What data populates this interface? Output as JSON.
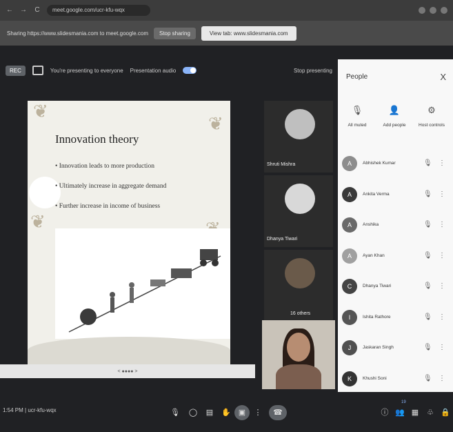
{
  "browser": {
    "url": "meet.google.com/ucr-kfu-wqx",
    "back": "←",
    "forward": "→",
    "reload": "C"
  },
  "share_bar": {
    "text": "Sharing https://www.slidesmania.com to meet.google.com",
    "stop_label": "Stop sharing",
    "view_label": "View tab: www.slidesmania.com"
  },
  "present_bar": {
    "rec": "REC",
    "presenting_text": "You're presenting to everyone",
    "audio_label": "Presentation audio",
    "stop_label": "Stop presenting"
  },
  "slide": {
    "title": "Innovation theory",
    "bullets": [
      "• Innovation leads to more production",
      "• Ultimately increase in aggregate demand",
      "• Further increase in income of business"
    ],
    "page_indicator": "< ●●●● >"
  },
  "tiles": [
    {
      "name": "Shruti Mishra"
    },
    {
      "name": "Dhanya Tiwari"
    },
    {
      "name": "16 others"
    }
  ],
  "people_panel": {
    "title": "People",
    "close": "X",
    "actions": [
      {
        "icon": "mic-off-icon",
        "glyph": "🎙",
        "label": "All muted"
      },
      {
        "icon": "add-person-icon",
        "glyph": "👤",
        "label": "Add people"
      },
      {
        "icon": "host-controls-icon",
        "glyph": "⚙",
        "label": "Host controls"
      }
    ],
    "participants": [
      {
        "initial": "A",
        "name": "Abhishek Kumar",
        "color": "#8d8d8d"
      },
      {
        "initial": "A",
        "name": "Ankita Verma",
        "color": "#3a3a3a"
      },
      {
        "initial": "A",
        "name": "Anshika",
        "color": "#6a6a6a"
      },
      {
        "initial": "A",
        "name": "Ayan Khan",
        "color": "#a0a0a0"
      },
      {
        "initial": "C",
        "name": "Dhanya Tiwari",
        "color": "#444444"
      },
      {
        "initial": "I",
        "name": "Ishita Rathore",
        "color": "#555555"
      },
      {
        "initial": "J",
        "name": "Jaskaran Singh",
        "color": "#505050"
      },
      {
        "initial": "K",
        "name": "Khushi Soni",
        "color": "#333333"
      }
    ]
  },
  "bottom_bar": {
    "time_code": "1:54 PM | ucr-kfu-wqx",
    "controls": [
      {
        "name": "mic-icon",
        "glyph": "🎙"
      },
      {
        "name": "camera-icon",
        "glyph": "◯"
      },
      {
        "name": "captions-icon",
        "glyph": "▤"
      },
      {
        "name": "raise-hand-icon",
        "glyph": "✋"
      },
      {
        "name": "present-icon",
        "glyph": "▣"
      },
      {
        "name": "more-options-icon",
        "glyph": "⋮"
      },
      {
        "name": "end-call-icon",
        "glyph": "☎"
      }
    ],
    "right_controls": [
      {
        "name": "info-icon",
        "glyph": "ⓘ"
      },
      {
        "name": "people-icon",
        "glyph": "👥"
      },
      {
        "name": "chat-icon",
        "glyph": "▦"
      },
      {
        "name": "activities-icon",
        "glyph": "♧"
      },
      {
        "name": "lock-icon",
        "glyph": "🔒"
      }
    ],
    "people_count": "19"
  }
}
